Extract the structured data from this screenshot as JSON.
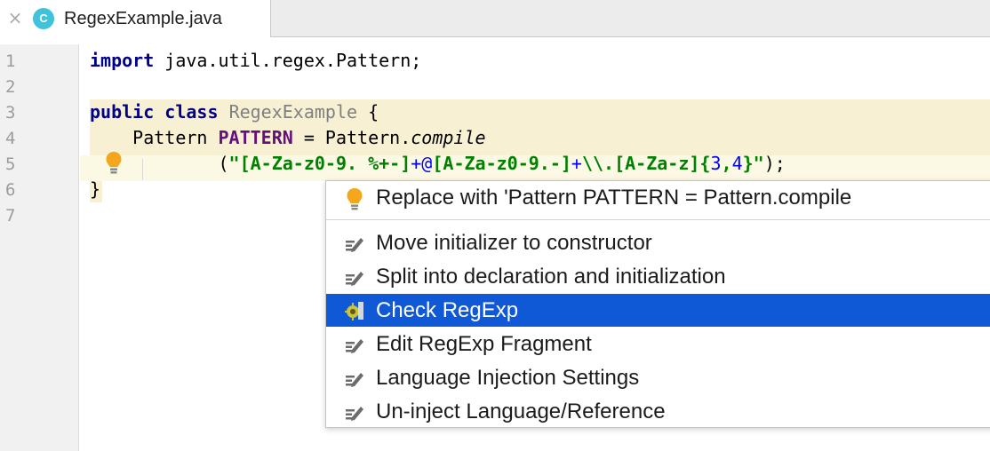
{
  "tab": {
    "close_glyph": "×",
    "file_icon_letter": "C",
    "title": "RegexExample.java"
  },
  "editor": {
    "line_numbers": [
      "1",
      "2",
      "3",
      "4",
      "5",
      "6",
      "7"
    ],
    "code": {
      "l1_kw": "import",
      "l1_rest": " java.util.regex.Pattern;",
      "l3_kw1": "public",
      "l3_kw2": "class",
      "l3_cls": "RegexExample",
      "l3_brace": "{",
      "l4_indent": "    ",
      "l4_type": "Pattern ",
      "l4_field": "PATTERN",
      "l4_eq": " = Pattern.",
      "l4_method": "compile",
      "l5_indent": "            ",
      "l5_open": "(",
      "l5_s1": "\"[",
      "l5_s2": "A-Za-z0-9. %+-",
      "l5_s3": "]",
      "l5_s4": "+@",
      "l5_s5": "[",
      "l5_s6": "A-Za-z0-9.-",
      "l5_s7": "]",
      "l5_s8": "+",
      "l5_s9": "\\\\.",
      "l5_s10": "[",
      "l5_s11": "A-Za-z",
      "l5_s12": "]",
      "l5_s13": "{",
      "l5_n1": "3",
      "l5_s14": ",",
      "l5_n2": "4",
      "l5_s15": "}",
      "l5_s16": "\"",
      "l5_close": ");",
      "l6_brace": "}"
    }
  },
  "popup": {
    "items": [
      {
        "label": "Replace with 'Pattern PATTERN = Pattern.compile",
        "icon": "lightbulb-icon"
      },
      {
        "label": "Move initializer to constructor",
        "icon": "intention-icon"
      },
      {
        "label": "Split into declaration and initialization",
        "icon": "intention-icon"
      },
      {
        "label": "Check RegExp",
        "icon": "regexp-check-icon",
        "selected": true
      },
      {
        "label": "Edit RegExp Fragment",
        "icon": "intention-icon"
      },
      {
        "label": "Language Injection Settings",
        "icon": "intention-icon"
      },
      {
        "label": "Un-inject Language/Reference",
        "icon": "intention-icon"
      }
    ]
  },
  "colors": {
    "accent_selection": "#0f58d6",
    "keyword": "#00008b",
    "string": "#008000",
    "field": "#660e7a",
    "bulb": "#f4a71d"
  }
}
